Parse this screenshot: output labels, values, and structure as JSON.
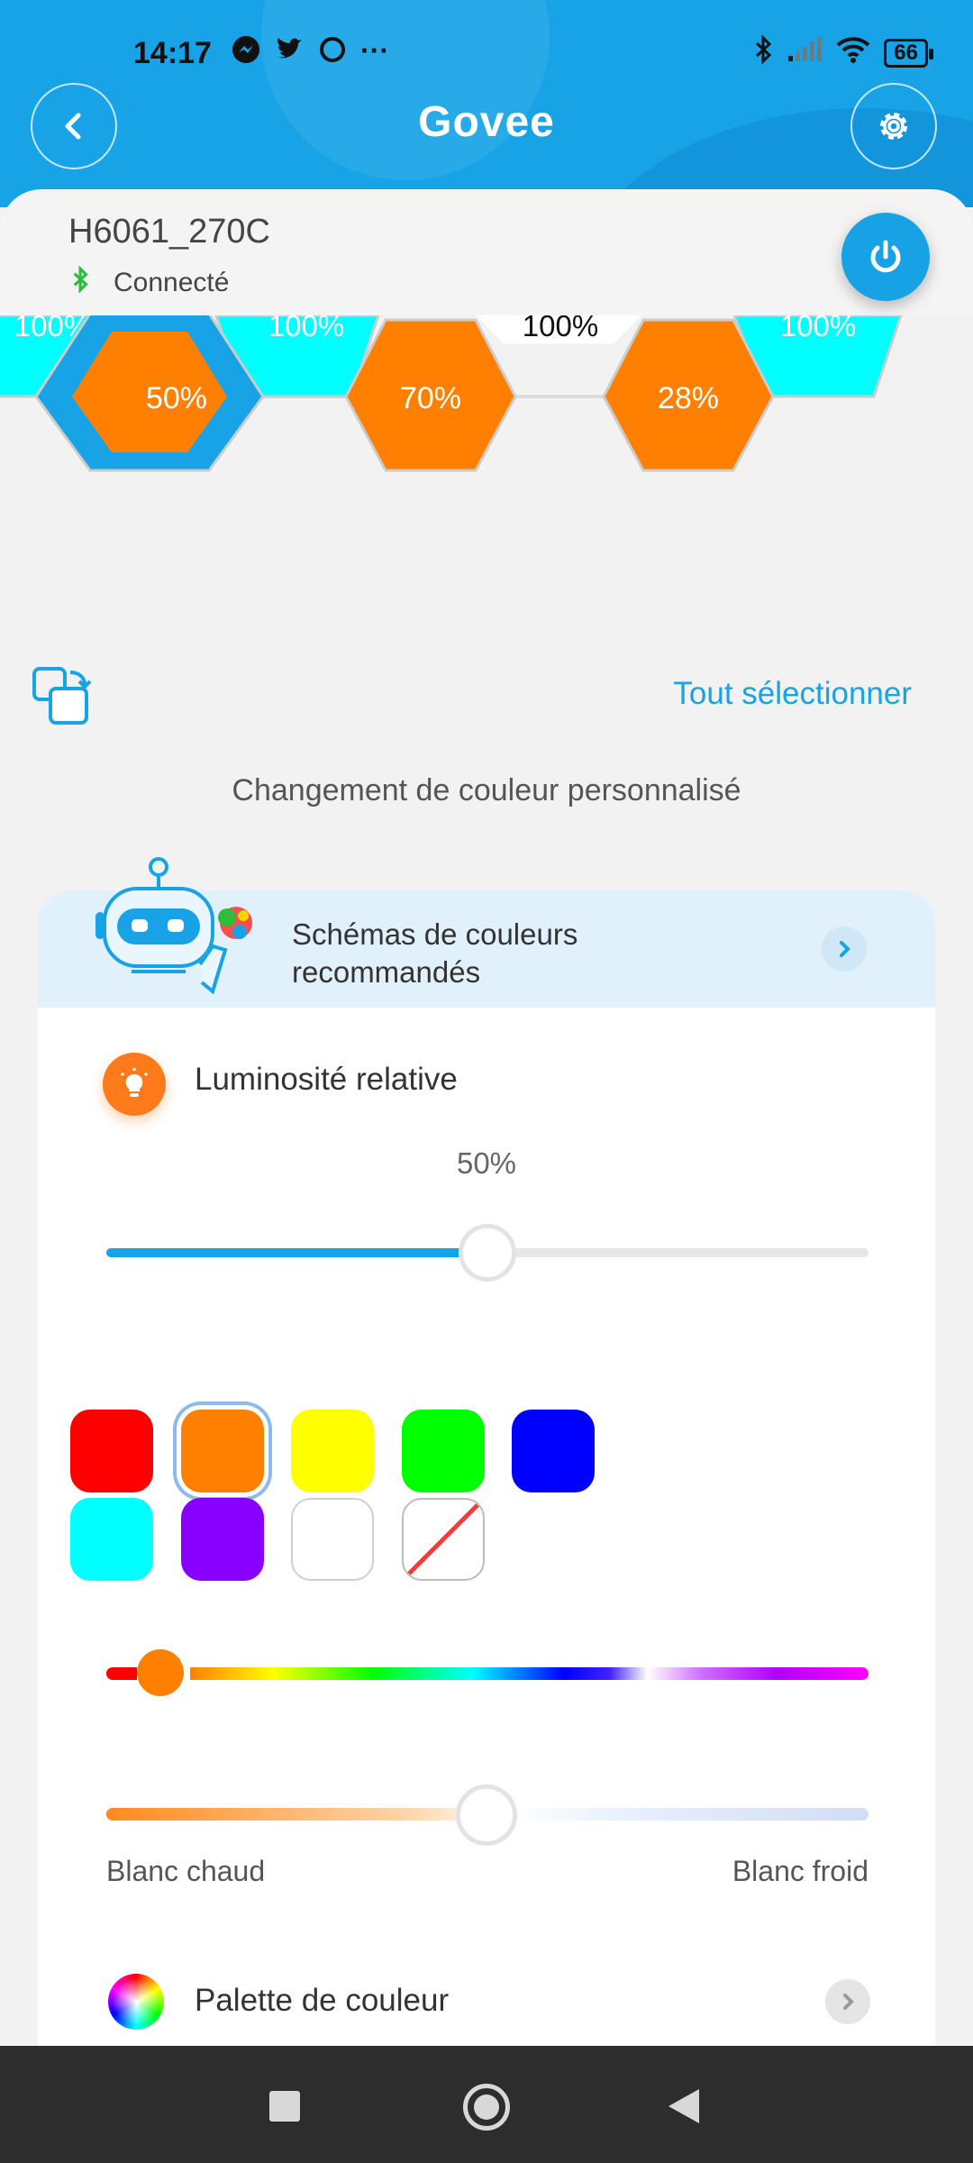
{
  "status_bar": {
    "time": "14:17",
    "more": "···",
    "battery": "66",
    "left_icons": [
      "messenger-icon",
      "twitter-icon",
      "circle-app-icon"
    ],
    "right_icons": [
      "bluetooth-icon",
      "signal-icon",
      "wifi-icon",
      "battery-icon"
    ]
  },
  "header": {
    "brand": "Govee",
    "back_icon": "back-arrow-icon",
    "settings_icon": "gear-icon"
  },
  "device": {
    "name": "H6061_270C",
    "connection": "Connecté",
    "power_icon": "power-icon"
  },
  "panels": {
    "top_row": [
      "100%",
      "100%",
      "100%",
      "100%"
    ],
    "bottom_row": [
      {
        "label": "50%",
        "color": "#ff8000",
        "selected": true
      },
      {
        "label": "70%",
        "color": "#ff8000",
        "selected": false
      },
      {
        "label": "28%",
        "color": "#ff8000",
        "selected": false
      }
    ]
  },
  "toolbar": {
    "select_all": "Tout sélectionner"
  },
  "section": {
    "title": "Changement de couleur personnalisé"
  },
  "recommend": {
    "label": "Schémas de couleurs recommandés"
  },
  "brightness": {
    "label": "Luminosité relative",
    "value": "50%",
    "fraction": 0.5
  },
  "swatches": [
    {
      "color": "#ff0000",
      "name": "red"
    },
    {
      "color": "#ff8000",
      "name": "orange",
      "selected": true
    },
    {
      "color": "#ffff00",
      "name": "yellow"
    },
    {
      "color": "#00ff00",
      "name": "green"
    },
    {
      "color": "#0000ff",
      "name": "blue"
    },
    {
      "color": "#00ffff",
      "name": "cyan"
    },
    {
      "color": "#8800ff",
      "name": "purple"
    },
    {
      "color": "#ffffff",
      "name": "white"
    },
    {
      "color": "none",
      "name": "off"
    }
  ],
  "color_temp": {
    "warm_label": "Blanc chaud",
    "cool_label": "Blanc froid",
    "fraction": 0.5
  },
  "palette": {
    "label": "Palette de couleur"
  },
  "colors": {
    "accent": "#17a3e6",
    "selected_panel": "#ff8000",
    "unlit_panel": "#00ffff"
  }
}
